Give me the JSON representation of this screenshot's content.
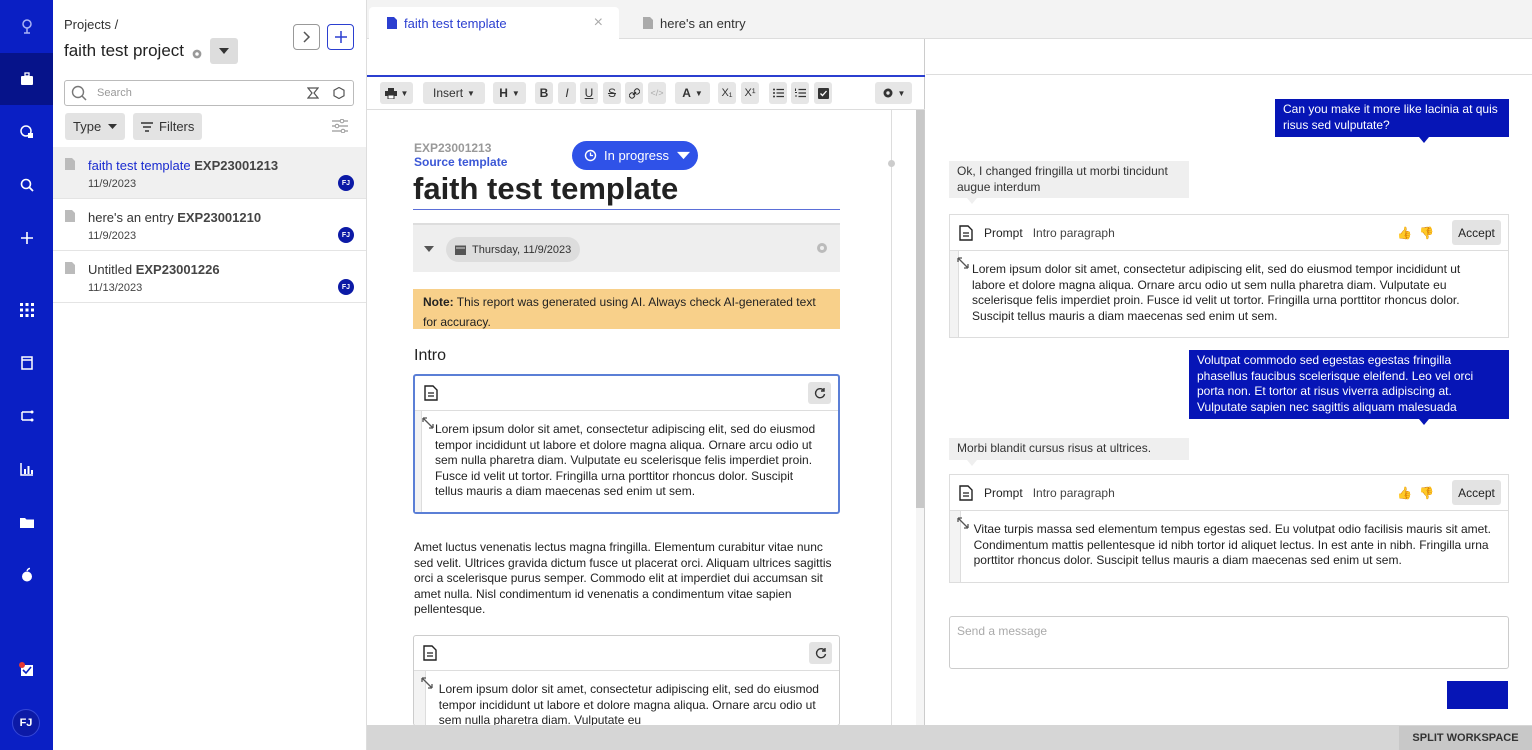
{
  "colors": {
    "brand": "#0a1fc4",
    "accent": "#2b3fd0",
    "status_pill": "#2f52e8",
    "user_bubble": "#0615b6",
    "note_bg": "#f8d08a"
  },
  "rail": {
    "icons": [
      "logo-icon",
      "briefcase-icon",
      "workflow-icon",
      "search-icon",
      "plus-icon",
      "grid-icon",
      "notebook-icon",
      "transfer-icon",
      "chart-icon",
      "folder-icon",
      "apple-icon",
      "inbox-icon"
    ],
    "avatar": "FJ"
  },
  "projects": {
    "crumb": "Projects /",
    "title": "faith test project",
    "search_placeholder": "Search",
    "type_label": "Type",
    "filters_label": "Filters",
    "items": [
      {
        "title": "faith test template",
        "id": "EXP23001213",
        "date": "11/9/2023",
        "avatar": "FJ"
      },
      {
        "title": "here's an entry",
        "id": "EXP23001210",
        "date": "11/9/2023",
        "avatar": "FJ"
      },
      {
        "title": "Untitled",
        "id": "EXP23001226",
        "date": "11/13/2023",
        "avatar": "FJ"
      }
    ]
  },
  "tabs": [
    {
      "label": "faith test template"
    },
    {
      "label": "here's an entry"
    }
  ],
  "toolbar": {
    "insert": "Insert",
    "heading": "H",
    "bold": "B",
    "italic": "I",
    "underline": "U",
    "strike": "S",
    "font_color": "A",
    "subscript": "X₁",
    "superscript": "X¹"
  },
  "document": {
    "exp_id": "EXP23001213",
    "source_link": "Source template",
    "status": "In progress",
    "title": "faith test template",
    "date": "Thursday, 11/9/2023",
    "note_label": "Note:",
    "note_text": " This report was generated using AI. Always check AI-generated text for accuracy.",
    "section": "Intro",
    "prompt1_text": "Lorem ipsum dolor sit amet, consectetur adipiscing elit, sed do eiusmod tempor incididunt ut labore et dolore magna aliqua. Ornare arcu odio ut sem nulla pharetra diam. Vulputate eu scelerisque felis imperdiet proin. Fusce id velit ut tortor. Fringilla urna porttitor rhoncus dolor. Suscipit tellus mauris a diam maecenas sed enim ut sem.",
    "body_para": "Amet luctus venenatis lectus magna fringilla. Elementum curabitur vitae nunc sed velit. Ultrices gravida dictum fusce ut placerat orci. Aliquam ultrices sagittis orci a scelerisque purus semper. Commodo elit at imperdiet dui accumsan sit amet nulla. Nisl condimentum id venenatis a condimentum vitae sapien pellentesque.",
    "prompt2_text": "Lorem ipsum dolor sit amet, consectetur adipiscing elit, sed do eiusmod tempor incididunt ut labore et dolore magna aliqua. Ornare arcu odio ut sem nulla pharetra diam. Vulputate eu"
  },
  "chat": {
    "messages": [
      {
        "role": "user",
        "text": "Can you make it more like lacinia at quis risus sed vulputate?"
      },
      {
        "role": "bot",
        "text": "Ok, I changed fringilla ut morbi tincidunt augue interdum"
      },
      {
        "role": "card",
        "label": "Prompt",
        "value": "Intro paragraph",
        "accept": "Accept",
        "text": "Lorem ipsum dolor sit amet, consectetur adipiscing elit, sed do eiusmod tempor incididunt ut labore et dolore magna aliqua. Ornare arcu odio ut sem nulla pharetra diam. Vulputate eu scelerisque felis imperdiet proin. Fusce id velit ut tortor. Fringilla urna porttitor rhoncus dolor. Suscipit tellus mauris a diam maecenas sed enim ut sem."
      },
      {
        "role": "user",
        "text": "Volutpat commodo sed egestas egestas fringilla phasellus faucibus scelerisque eleifend. Leo vel orci porta non. Et tortor at risus viverra adipiscing at. Vulputate sapien nec sagittis aliquam malesuada"
      },
      {
        "role": "bot",
        "text": "Morbi blandit cursus risus at ultrices."
      },
      {
        "role": "card",
        "label": "Prompt",
        "value": "Intro paragraph",
        "accept": "Accept",
        "text": "Vitae turpis massa sed elementum tempus egestas sed. Eu volutpat odio facilisis mauris sit amet. Condimentum mattis pellentesque id nibh tortor id aliquet lectus. In est ante in nibh. Fringilla urna porttitor rhoncus dolor. Suscipit tellus mauris a diam maecenas sed enim ut sem."
      }
    ],
    "input_placeholder": "Send a message"
  },
  "footer": {
    "split_label": "SPLIT WORKSPACE"
  }
}
